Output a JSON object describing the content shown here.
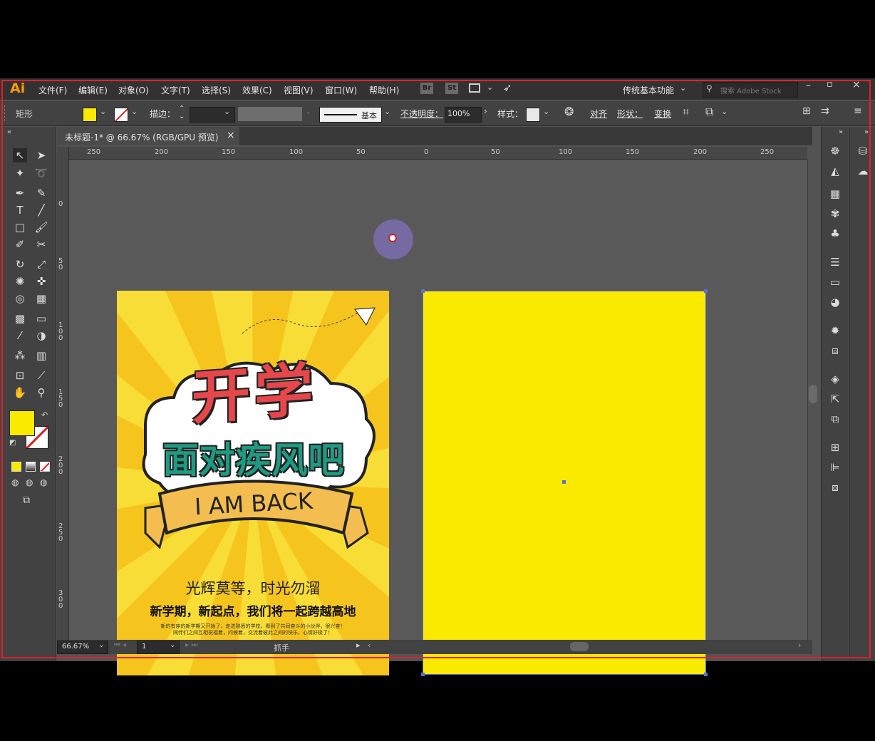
{
  "app": {
    "logo": "Ai"
  },
  "menu": [
    "文件(F)",
    "编辑(E)",
    "对象(O)",
    "文字(T)",
    "选择(S)",
    "效果(C)",
    "视图(V)",
    "窗口(W)",
    "帮助(H)"
  ],
  "header_right": {
    "br": "Br",
    "st": "St",
    "workspace": "传统基本功能",
    "search_placeholder": "搜索 Adobe Stock"
  },
  "control": {
    "tool_label": "矩形",
    "stroke_label": "描边：",
    "stroke_style": "基本",
    "opacity_label": "不透明度：",
    "opacity_value": "100%",
    "style_label": "样式：",
    "align": "对齐",
    "shape": "形状：",
    "transform": "变换"
  },
  "tab": {
    "title": "未标题-1* @ 66.67% (RGB/GPU 预览)",
    "close": "×"
  },
  "ruler": {
    "h": [
      "250",
      "200",
      "150",
      "100",
      "50",
      "0",
      "50",
      "100",
      "150",
      "200",
      "250"
    ],
    "v": [
      "0",
      "50",
      "100",
      "150",
      "200",
      "250",
      "300"
    ]
  },
  "status": {
    "zoom": "66.67%",
    "page": "1",
    "tool": "抓手"
  },
  "poster": {
    "title": "开学",
    "subtitle": "面对疾风吧",
    "banner": "I AM BACK",
    "line1": "光辉莫等，时光勿溜",
    "line2": "新学期，新起点，我们将一起跨越高地",
    "small1": "新的有序的新学期又开始了，走进熟悉的学校，看到了共同奋斗的小伙伴，很兴奋！",
    "small2": "同伴们之间互相祝福着，问候着，交流着彼此之间的快乐，心情好极了！"
  },
  "colors": {
    "fill": "#f9ea00",
    "poster_bg": "#f5c51e",
    "title": "#e5474b",
    "subtitle": "#1f9a82",
    "accent": "#ff9a00"
  }
}
